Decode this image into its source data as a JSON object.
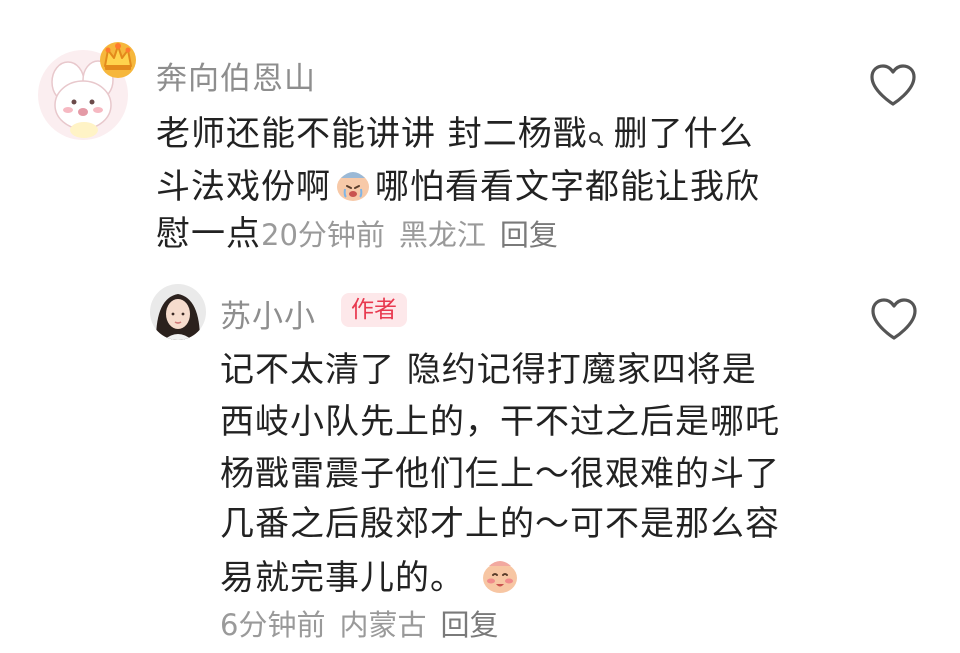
{
  "comment1": {
    "username": "奔向伯恩山",
    "line1_a": "老师还能不能讲讲 封二杨戬",
    "line1_b": " 删了什么",
    "line2_a": "斗法戏份啊",
    "line2_b": "哪怕看看文字都能让我欣",
    "line3_text": "慰一点",
    "time": "20分钟前",
    "location": "黑龙江",
    "reply": "回复",
    "avatar_icon": "cartoon-bunny-icon",
    "crown_icon": "crown-icon",
    "emoji_icon": "crying-face-emoji"
  },
  "comment2": {
    "username": "苏小小",
    "badge": "作者",
    "lines": [
      "记不太清了 隐约记得打魔家四将是",
      "西岐小队先上的，干不过之后是哪吒",
      "杨戬雷震子他们仨上～很艰难的斗了",
      "几番之后殷郊才上的～可不是那么容"
    ],
    "line5_text": "易就完事儿的。",
    "time": "6分钟前",
    "location": "内蒙古",
    "reply": "回复",
    "avatar_icon": "woman-portrait-icon",
    "emoji_icon": "blushing-face-emoji"
  },
  "icons": {
    "like": "heart-outline-icon",
    "search": "search-icon"
  },
  "colors": {
    "text": "#222222",
    "meta": "#9a9a9a",
    "badge_bg": "#fde8ea",
    "badge_text": "#e8394f"
  }
}
